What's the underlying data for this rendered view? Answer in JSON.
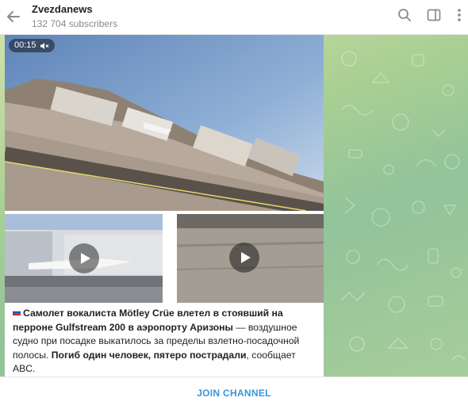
{
  "header": {
    "channel_name": "Zvezdanews",
    "subscribers": "132 704 subscribers",
    "back_icon": "arrow-left-icon",
    "search_icon": "search-icon",
    "sidebar_icon": "sidebar-toggle-icon",
    "menu_icon": "more-vertical-icon"
  },
  "message": {
    "video_duration": "00:15",
    "mute_icon": "muted-speaker-icon",
    "caption": {
      "flag_icon": "russian-flag-icon",
      "bold_1": "Самолет вокалиста Mötley Crüe влетел в стоявший на перроне Gulfstream 200 в аэропорту Аризоны",
      "text_1": " — воздушное судно при посадке выкатилось за пределы взлетно-посадочной полосы. ",
      "bold_2": "Погиб один человек, пятеро пострадали",
      "text_2": ", сообщает ABC."
    }
  },
  "footer": {
    "join_label": "JOIN CHANNEL"
  },
  "colors": {
    "accent": "#3a95d6",
    "chat_background": "#a9cf93"
  }
}
